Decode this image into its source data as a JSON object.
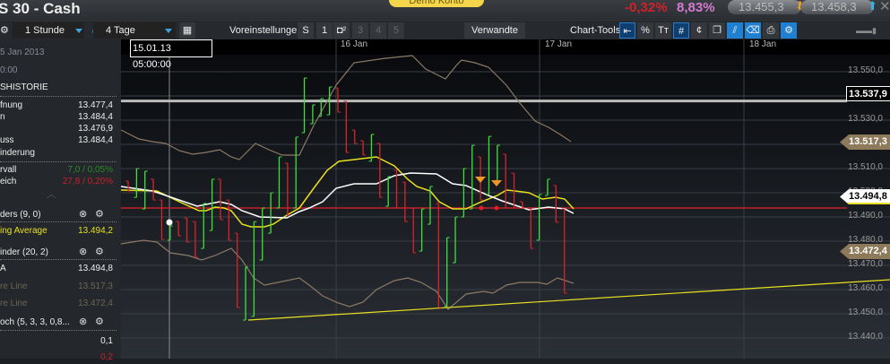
{
  "title": "S 30 - Cash",
  "demo_label": "Demo Konto",
  "change_pct": "-0,32%",
  "change_pct2": "8,83%",
  "bid": "13.455,3",
  "ask": "13.458,3",
  "toolbar": {
    "interval": "1 Stunde",
    "range": "4 Tage",
    "presets_label": "Voreinstellungen",
    "presets": [
      "S",
      "1",
      "",
      "3",
      "4",
      "5"
    ],
    "related": "Verwandte",
    "chart_tools_label": "Chart-Tools"
  },
  "crosshair_time": "15.01.13 05:00:00",
  "dates": [
    "16 Jan",
    "17 Jan",
    "18 Jan"
  ],
  "panel": {
    "date": "5 Jan 2013",
    "time": "0:00",
    "section": "SHISTORIE",
    "rows": [
      {
        "label": "fnung",
        "value": "13.477,4"
      },
      {
        "label": "n",
        "value": "13.484,4"
      },
      {
        "label": "",
        "value": "13.476,9"
      },
      {
        "label": "uss",
        "value": "13.484,4"
      },
      {
        "label": "inderung",
        "value": ""
      }
    ],
    "range_label": "rvall",
    "range_value": "7,0 / 0,05%",
    "compare_label": "eich",
    "compare_value": "27,8 / 0,20%",
    "ind1": "ders (9, 0)",
    "ind1_line": "ing Average",
    "ind1_value": "13.494,2",
    "ind2": "inder (20, 2)",
    "ind2_mid": "A",
    "ind2_mid_value": "13.494,8",
    "ind2_up": "re Line",
    "ind2_up_value": "13.517,3",
    "ind2_lo": "re Line",
    "ind2_lo_value": "13.472,4",
    "ind3": "och (5, 3, 3, 0,8...",
    "ind3_v1": "0,1",
    "ind3_v2": "0,2"
  },
  "price_labels": [
    "13.550,0",
    "13.540,0",
    "13.530,0",
    "13.520,0",
    "13.510,0",
    "13.500,0",
    "13.490,0",
    "13.480,0",
    "13.470,0",
    "13.460,0",
    "13.450,0",
    "13.440,0"
  ],
  "tags": {
    "hline": "13.537,9",
    "upper": "13.517,3",
    "mid": "13.494,8",
    "lower": "13.472,4"
  },
  "colors": {
    "up": "#3ee03e",
    "down": "#d8242c",
    "ma": "#e8e020",
    "mid": "#ffffff",
    "band": "#8a7a66"
  },
  "chart_data": {
    "type": "ohlc",
    "ylim": [
      13435,
      13555
    ],
    "bars": [
      [
        13504.8,
        13500.7,
        "d"
      ],
      [
        13510,
        13498.1,
        "u"
      ],
      [
        13508.9,
        13493.3,
        "u"
      ],
      [
        13505.6,
        13497,
        "d"
      ],
      [
        13497,
        13480.7,
        "d"
      ],
      [
        13486.3,
        13480.4,
        "u"
      ],
      [
        13488.1,
        13482.2,
        "d"
      ],
      [
        13489.6,
        13479.6,
        "d"
      ],
      [
        13488.1,
        13473.3,
        "d"
      ],
      [
        13495.6,
        13477,
        "u"
      ],
      [
        13505.6,
        13484.4,
        "u"
      ],
      [
        13505.6,
        13488.9,
        "d"
      ],
      [
        13497,
        13480.4,
        "d"
      ],
      [
        13483.3,
        13452.6,
        "d"
      ],
      [
        13469.3,
        13447.4,
        "u"
      ],
      [
        13488.1,
        13448.9,
        "u"
      ],
      [
        13493.7,
        13472.2,
        "u"
      ],
      [
        13500,
        13483.3,
        "u"
      ],
      [
        13514.8,
        13493.7,
        "u"
      ],
      [
        13512.2,
        13490.7,
        "d"
      ],
      [
        13523,
        13493.7,
        "u"
      ],
      [
        13547.4,
        13524.8,
        "u"
      ],
      [
        13536.3,
        13528.5,
        "u"
      ],
      [
        13538.9,
        13531.5,
        "u"
      ],
      [
        13543.7,
        13532.2,
        "u"
      ],
      [
        13543.3,
        13533.3,
        "d"
      ],
      [
        13537.8,
        13516.7,
        "d"
      ],
      [
        13525.9,
        13520.4,
        "d"
      ],
      [
        13521.5,
        13515.6,
        "d"
      ],
      [
        13524.1,
        13513,
        "u"
      ],
      [
        13520.4,
        13498.1,
        "d"
      ],
      [
        13506.7,
        13494.4,
        "u"
      ],
      [
        13509.3,
        13493.7,
        "d"
      ],
      [
        13504.4,
        13488.1,
        "d"
      ],
      [
        13493.7,
        13475.2,
        "d"
      ],
      [
        13493.3,
        13475.9,
        "u"
      ],
      [
        13502.6,
        13487,
        "u"
      ],
      [
        13495.6,
        13452.6,
        "d"
      ],
      [
        13481.5,
        13453,
        "u"
      ],
      [
        13490,
        13471.1,
        "u"
      ],
      [
        13510,
        13490,
        "u"
      ],
      [
        13519.6,
        13493.3,
        "u"
      ],
      [
        13514.8,
        13497,
        "d"
      ],
      [
        13523.3,
        13499.3,
        "u"
      ],
      [
        13519.6,
        13504.8,
        "u"
      ],
      [
        13515.9,
        13493.7,
        "d"
      ],
      [
        13508.1,
        13493.7,
        "d"
      ],
      [
        13496.3,
        13493.7,
        "d"
      ],
      [
        13493.7,
        13477,
        "d"
      ],
      [
        13499.3,
        13480.4,
        "u"
      ],
      [
        13505.6,
        13498.9,
        "u"
      ],
      [
        13503,
        13487.8,
        "d"
      ],
      [
        13493.3,
        13458.5,
        "d"
      ]
    ],
    "hline": 13537.9,
    "support": 13494.8
  }
}
